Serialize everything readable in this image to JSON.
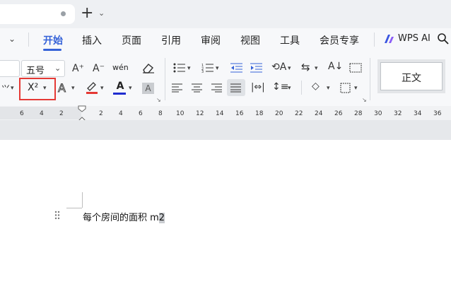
{
  "tabbar": {
    "new_tab": "+",
    "new_tab_chevron": "⌄"
  },
  "menu": {
    "chevron": "⌄",
    "items": [
      "开始",
      "插入",
      "页面",
      "引用",
      "审阅",
      "视图",
      "工具",
      "会员专享"
    ],
    "wps_ai": "WPS AI",
    "search_icon": "search-icon"
  },
  "ribbon": {
    "font_size": "五号",
    "font_size_chevron": "⌄",
    "grow_font": "A⁺",
    "shrink_font": "A⁻",
    "phonetic": "wén",
    "superscript": "X²",
    "char_border": "A",
    "font_color": "A",
    "char_shading": "A",
    "style_normal": "正文",
    "font_color_hex": "#1f2ccf",
    "highlight_color_hex": "#e53935"
  },
  "ruler": {
    "ticks_left": [
      "6",
      "4",
      "2"
    ],
    "ticks_right": [
      "2",
      "4",
      "6",
      "8",
      "10",
      "12",
      "14",
      "16",
      "18",
      "20",
      "22",
      "24",
      "26",
      "28",
      "30",
      "32",
      "34",
      "36"
    ]
  },
  "document": {
    "text": "每个房间的面积 m",
    "selected_text": "2"
  }
}
